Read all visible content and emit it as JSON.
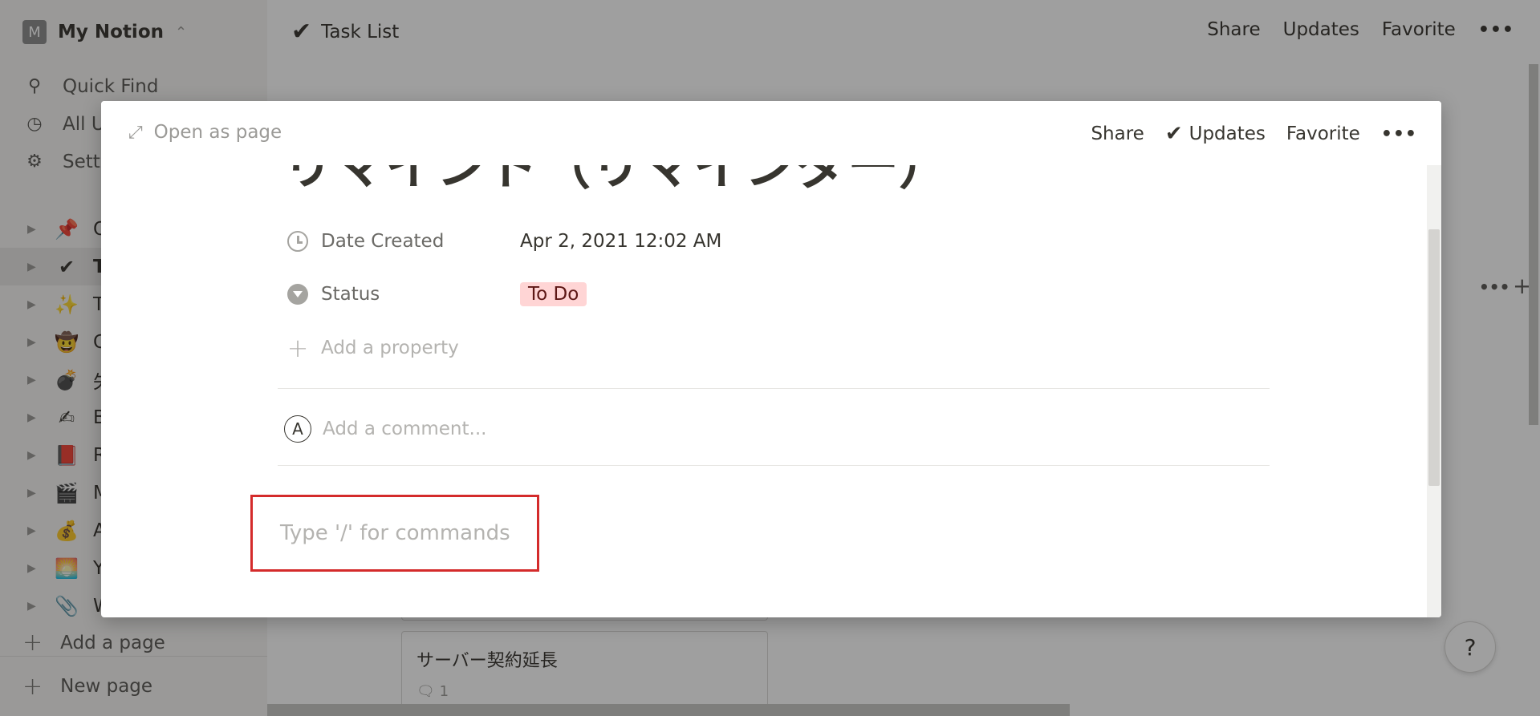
{
  "workspace": {
    "badge": "M",
    "name": "My Notion",
    "switch_icon": "chevron-updown-icon"
  },
  "sidebar": {
    "nav": [
      {
        "icon": "search-icon",
        "label": "Quick Find"
      },
      {
        "icon": "clock-icon",
        "label": "All U"
      },
      {
        "icon": "gear-icon",
        "label": "Setti"
      }
    ],
    "pages": [
      {
        "emoji": "📌",
        "label": "Q",
        "active": false
      },
      {
        "emoji": "✔",
        "label": "Ta",
        "active": true
      },
      {
        "emoji": "✨",
        "label": "Th",
        "active": false
      },
      {
        "emoji": "🤠",
        "label": "C",
        "active": false
      },
      {
        "emoji": "💣",
        "label": "失",
        "active": false
      },
      {
        "emoji": "✍",
        "label": "Bl",
        "active": false
      },
      {
        "emoji": "📕",
        "label": "Re",
        "active": false
      },
      {
        "emoji": "🎬",
        "label": "M",
        "active": false
      },
      {
        "emoji": "💰",
        "label": "A",
        "active": false
      },
      {
        "emoji": "🌅",
        "label": "Ye",
        "active": false
      },
      {
        "emoji": "📎",
        "label": "W",
        "active": false
      }
    ],
    "add_page": "Add a page",
    "new_page": "New page"
  },
  "topbar": {
    "breadcrumb": "Task List",
    "share": "Share",
    "updates": "Updates",
    "favorite": "Favorite"
  },
  "background": {
    "card_title": "サーバー契約延長",
    "card_comments": "1",
    "help": "?"
  },
  "modal": {
    "open_as_page": "Open as page",
    "share": "Share",
    "updates": "Updates",
    "favorite": "Favorite",
    "title": "リマインド（リマインダー）",
    "properties": {
      "date_created_label": "Date Created",
      "date_created_value": "Apr 2, 2021 12:02 AM",
      "status_label": "Status",
      "status_value": "To Do",
      "add_property": "Add a property"
    },
    "comment": {
      "avatar": "A",
      "placeholder": "Add a comment..."
    },
    "command_placeholder": "Type '/' for commands"
  },
  "colors": {
    "status_tag_bg": "#ffd5d5",
    "highlight_box": "#d42b2b"
  }
}
